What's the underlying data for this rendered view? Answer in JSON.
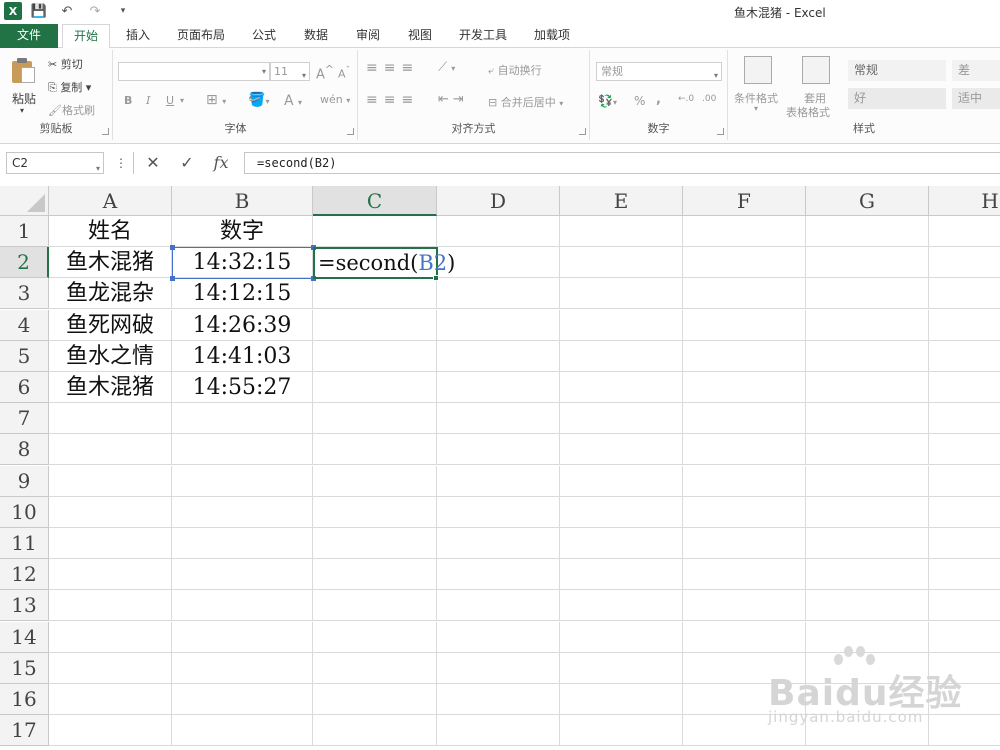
{
  "window": {
    "title": "鱼木混猪 - Excel",
    "app_icon": "X"
  },
  "qat": {
    "save_icon": "save-icon",
    "undo_icon": "undo-icon",
    "redo_icon": "redo-icon",
    "customize_icon": "customize-qat-icon"
  },
  "tabs": {
    "file": "文件",
    "home": "开始",
    "insert": "插入",
    "page_layout": "页面布局",
    "formulas": "公式",
    "data": "数据",
    "review": "审阅",
    "view": "视图",
    "developer": "开发工具",
    "addins": "加载项"
  },
  "ribbon": {
    "clipboard": {
      "label": "剪贴板",
      "paste": "粘贴",
      "cut": "剪切",
      "copy": "复制",
      "format_painter": "格式刷"
    },
    "font": {
      "label": "字体",
      "font_name": "",
      "font_size": "11",
      "bold": "B",
      "italic": "I",
      "underline": "U"
    },
    "alignment": {
      "label": "对齐方式",
      "wrap_text": "自动换行",
      "merge_center": "合并后居中"
    },
    "number": {
      "label": "数字",
      "format": "常规",
      "percent": "%",
      "comma": ","
    },
    "styles": {
      "label": "样式",
      "conditional_formatting": "条件格式",
      "format_as_table_line1": "套用",
      "format_as_table_line2": "表格格式",
      "normal": "常规",
      "bad": "差",
      "good": "好",
      "neutral": "适中"
    }
  },
  "formula_bar": {
    "name_box": "C2",
    "cancel": "✕",
    "enter": "✓",
    "fx": "fx",
    "formula": "=second(B2)"
  },
  "grid": {
    "columns": [
      "A",
      "B",
      "C",
      "D",
      "E",
      "F",
      "G",
      "H"
    ],
    "rows": [
      "1",
      "2",
      "3",
      "4",
      "5",
      "6",
      "7",
      "8",
      "9",
      "10",
      "11",
      "12",
      "13",
      "14",
      "15",
      "16",
      "17"
    ],
    "cells": {
      "A1": "姓名",
      "B1": "数字",
      "A2": "鱼木混猪",
      "B2": "14:32:15",
      "A3": "鱼龙混杂",
      "B3": "14:12:15",
      "A4": "鱼死网破",
      "B4": "14:26:39",
      "A5": "鱼水之情",
      "B5": "14:41:03",
      "A6": "鱼木混猪",
      "B6": "14:55:27"
    },
    "editing": {
      "prefix": "=second(",
      "ref": "B2",
      "suffix": ")"
    },
    "active_cell": "C2"
  },
  "watermark": {
    "logo": "Baidu经验",
    "url": "jingyan.baidu.com"
  },
  "colors": {
    "excel_green": "#217346",
    "ref_blue": "#4472c4"
  }
}
